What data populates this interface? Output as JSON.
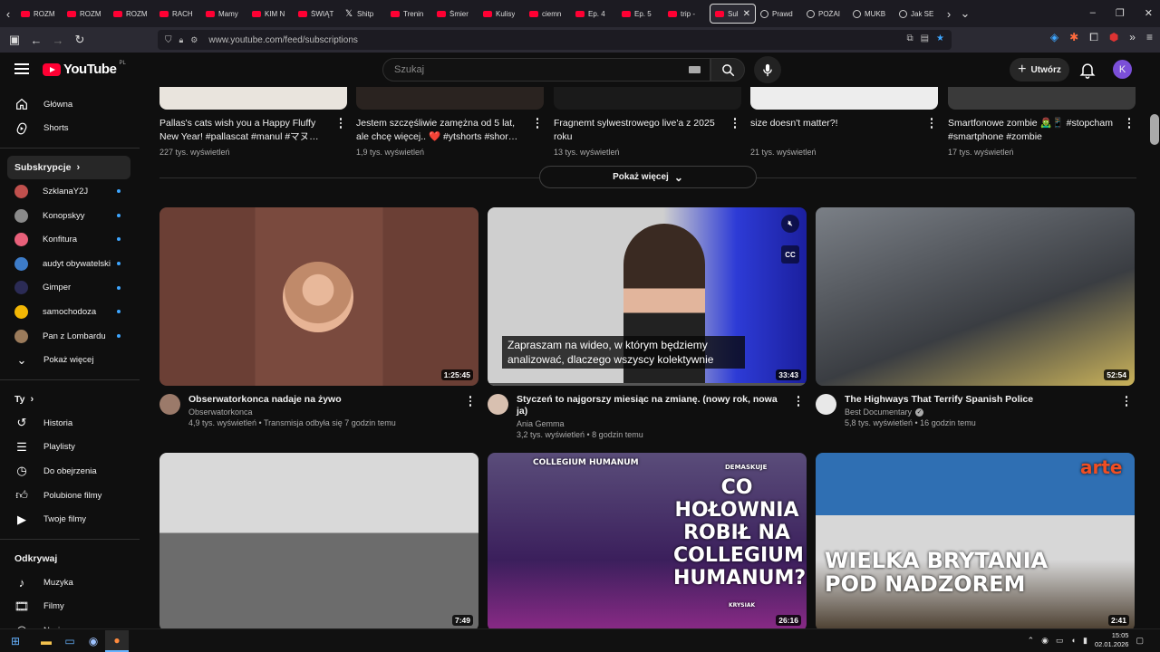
{
  "browser": {
    "tabs": [
      {
        "title": "ROZM",
        "icon": "youtube-icon"
      },
      {
        "title": "ROZM",
        "icon": "youtube-icon"
      },
      {
        "title": "ROZM",
        "icon": "youtube-icon"
      },
      {
        "title": "RACH",
        "icon": "youtube-icon"
      },
      {
        "title": "Mamy",
        "icon": "youtube-icon"
      },
      {
        "title": "KIM N",
        "icon": "youtube-icon"
      },
      {
        "title": "ŚWIĄT",
        "icon": "youtube-icon"
      },
      {
        "title": "Shitp",
        "icon": "x-icon"
      },
      {
        "title": "Trenin",
        "icon": "youtube-icon"
      },
      {
        "title": "Śmier",
        "icon": "youtube-icon"
      },
      {
        "title": "Kulisy",
        "icon": "youtube-icon"
      },
      {
        "title": "ciemn",
        "icon": "youtube-icon"
      },
      {
        "title": "Ep. 4",
        "icon": "youtube-icon"
      },
      {
        "title": "Ep. 5",
        "icon": "youtube-icon"
      },
      {
        "title": "trip -",
        "icon": "youtube-icon"
      },
      {
        "title": "Sub",
        "icon": "youtube-icon",
        "active": true
      },
      {
        "title": "Prawd",
        "icon": "youtube-icon"
      },
      {
        "title": "POŻAI",
        "icon": "youtube-icon"
      },
      {
        "title": "MUKB",
        "icon": "youtube-icon"
      },
      {
        "title": "Jak SE",
        "icon": "youtube-icon"
      }
    ],
    "url": "www.youtube.com/feed/subscriptions"
  },
  "header": {
    "logo_text": "YouTube",
    "country": "PL",
    "search_placeholder": "Szukaj",
    "create_label": "Utwórz",
    "avatar_letter": "K",
    "accent": "#ff0033"
  },
  "sidebar": {
    "main_items": [
      {
        "label": "Główna",
        "icon": "home-icon"
      },
      {
        "label": "Shorts",
        "icon": "shorts-icon"
      }
    ],
    "subscriptions_heading": "Subskrypcje",
    "subscriptions": [
      {
        "label": "SzklanaY2J",
        "color": "#c0504d"
      },
      {
        "label": "Konopskyy",
        "color": "#8a8a8a"
      },
      {
        "label": "Konfitura",
        "color": "#e8607a"
      },
      {
        "label": "audyt obywatelski",
        "color": "#3d7cc9"
      },
      {
        "label": "Gimper",
        "color": "#2b2b55"
      },
      {
        "label": "samochodoza",
        "color": "#f2b705"
      },
      {
        "label": "Pan z Lombardu",
        "color": "#9b7b5b"
      }
    ],
    "show_more": "Pokaż więcej",
    "you_heading": "Ty",
    "you_items": [
      {
        "label": "Historia",
        "icon": "history-icon"
      },
      {
        "label": "Playlisty",
        "icon": "playlist-icon"
      },
      {
        "label": "Do obejrzenia",
        "icon": "clock-icon"
      },
      {
        "label": "Polubione filmy",
        "icon": "thumbs-up-icon"
      },
      {
        "label": "Twoje filmy",
        "icon": "video-icon"
      }
    ],
    "explore_heading": "Odkrywaj",
    "explore_items": [
      {
        "label": "Muzyka",
        "icon": "music-icon"
      },
      {
        "label": "Filmy",
        "icon": "film-icon"
      },
      {
        "label": "Na żywo",
        "icon": "live-icon"
      }
    ]
  },
  "shorts": [
    {
      "title": "Pallas's cats wish you a Happy Fluffy New Year! #pallascat #manul #マヌ…",
      "views": "227 tys. wyświetleń"
    },
    {
      "title": "Jestem szczęśliwie zamężna od 5 lat, ale chcę więcej.. ❤️ #ytshorts #shor…",
      "views": "1,9 tys. wyświetleń"
    },
    {
      "title": "Fragnemt sylwestrowego live'a z 2025 roku",
      "views": "13 tys. wyświetleń"
    },
    {
      "title": "size doesn't matter?!",
      "views": "21 tys. wyświetleń"
    },
    {
      "title": "Smartfonowe zombie 🧟‍♂️📱 #stopcham #smartphone #zombie",
      "views": "17 tys. wyświetleń"
    }
  ],
  "show_more_button": "Pokaż więcej",
  "videos": [
    {
      "title": "Obserwatorkonca nadaje na żywo",
      "channel": "Obserwatorkonca",
      "stats": "4,9 tys. wyświetleń • Transmisja odbyła się 7 godzin temu",
      "duration": "1:25:45",
      "verified": false
    },
    {
      "title": "Styczeń to najgorszy miesiąc na zmianę. (nowy rok, nowa ja)",
      "channel": "Ania Gemma",
      "stats": "3,2 tys. wyświetleń • 8 godzin temu",
      "duration": "33:43",
      "verified": false,
      "caption": "Zapraszam na wideo, w którym będziemy analizować, dlaczego wszyscy kolektywnie",
      "cc_label": "CC"
    },
    {
      "title": "The Highways That Terrify Spanish Police",
      "channel": "Best Documentary",
      "stats": "5,8 tys. wyświetleń • 16 godzin temu",
      "duration": "52:54",
      "verified": true
    },
    {
      "duration": "7:49"
    },
    {
      "duration": "26:16",
      "thumb_text": "CO HOŁOWNIA ROBIŁ NA COLLEGIUM HUMANUM?",
      "thumb_sign": "COLLEGIUM HUMANUM",
      "thumb_author": "KRYSIAK",
      "thumb_brand": "DEMASKUJE"
    },
    {
      "duration": "2:41",
      "thumb_text": "WIELKA BRYTANIA POD NADZOREM",
      "thumb_brand": "arte"
    }
  ],
  "taskbar": {
    "time": "15:05",
    "date": "02.01.2026"
  }
}
